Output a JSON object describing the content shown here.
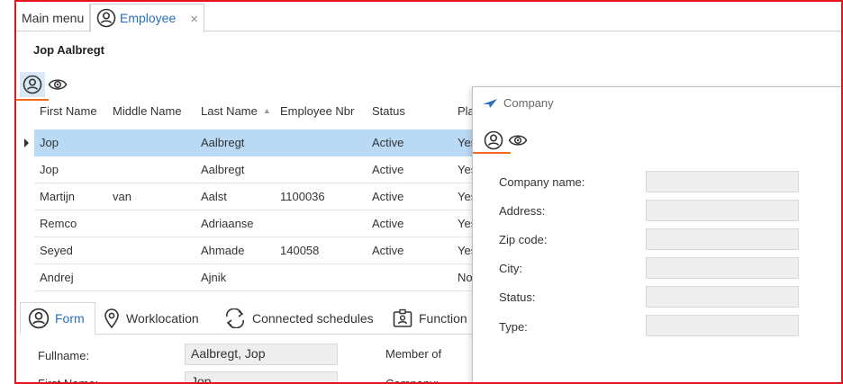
{
  "tabs": {
    "main_menu": "Main menu",
    "employee": "Employee",
    "close": "×"
  },
  "page_title": "Jop Aalbregt",
  "grid": {
    "columns": [
      "First Name",
      "Middle Name",
      "Last Name",
      "Employee Nbr",
      "Status",
      "Pla"
    ],
    "rows": [
      [
        "Jop",
        "",
        "Aalbregt",
        "",
        "Active",
        "Yes"
      ],
      [
        "Jop",
        "",
        "Aalbregt",
        "",
        "Active",
        "Yes"
      ],
      [
        "Martijn",
        "van",
        "Aalst",
        "1100036",
        "Active",
        "Yes"
      ],
      [
        "Remco",
        "",
        "Adriaanse",
        "",
        "Active",
        "Yes"
      ],
      [
        "Seyed",
        "",
        "Ahmade",
        "140058",
        "Active",
        "Yes"
      ],
      [
        "Andrej",
        "",
        "Ajnik",
        "",
        "",
        "No"
      ]
    ]
  },
  "lower_tabs": [
    "Form",
    "Worklocation",
    "Connected schedules",
    "Function"
  ],
  "form": {
    "fullname_label": "Fullname:",
    "fullname_value": "Aalbregt, Jop",
    "firstname_label": "First Name:",
    "firstname_value": "Jop",
    "member_of_label": "Member of",
    "company_label": "Company:"
  },
  "company_panel": {
    "title": "Company",
    "fields": [
      "Company name:",
      "Address:",
      "Zip code:",
      "City:",
      "Status:",
      "Type:"
    ]
  },
  "colors": {
    "accent": "#2a6ebb",
    "selection": "#b9d9f5",
    "highlight_border": "#e8131a",
    "underline": "#f26b1d"
  }
}
